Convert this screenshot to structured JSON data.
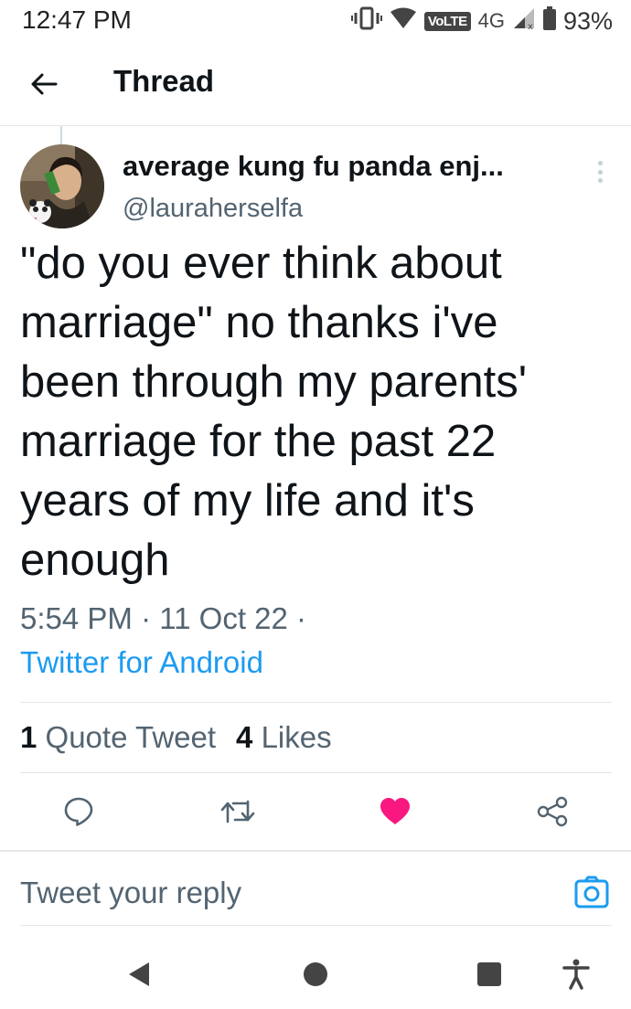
{
  "status_bar": {
    "time": "12:47 PM",
    "network_badge": "VoLTE",
    "network_type": "4G",
    "battery": "93%"
  },
  "header": {
    "title": "Thread"
  },
  "tweet": {
    "display_name": "average kung fu panda enj...",
    "handle": "@lauraherselfa",
    "text": "\"do you ever think about\nmarriage\" no thanks i've\nbeen through my parents'\nmarriage for the past 22\nyears of my life and it's\nenough",
    "timestamp": "5:54 PM · 11 Oct 22 ·",
    "source": "Twitter for Android",
    "stats": {
      "quote_count": "1",
      "quote_label": "Quote Tweet",
      "likes_count": "4",
      "likes_label": "Likes"
    }
  },
  "actions": {
    "reply_icon": "reply-icon",
    "retweet_icon": "retweet-icon",
    "like_icon": "heart-filled-icon",
    "share_icon": "share-icon",
    "like_color": "#f91880",
    "icon_color": "#536471"
  },
  "reply_box": {
    "placeholder": "Tweet your reply",
    "camera_icon": "camera-icon",
    "camera_color": "#1d9bf0"
  },
  "nav_bar": {
    "back": "nav-back-icon",
    "home": "nav-home-icon",
    "recents": "nav-recents-icon",
    "accessibility": "accessibility-icon"
  }
}
